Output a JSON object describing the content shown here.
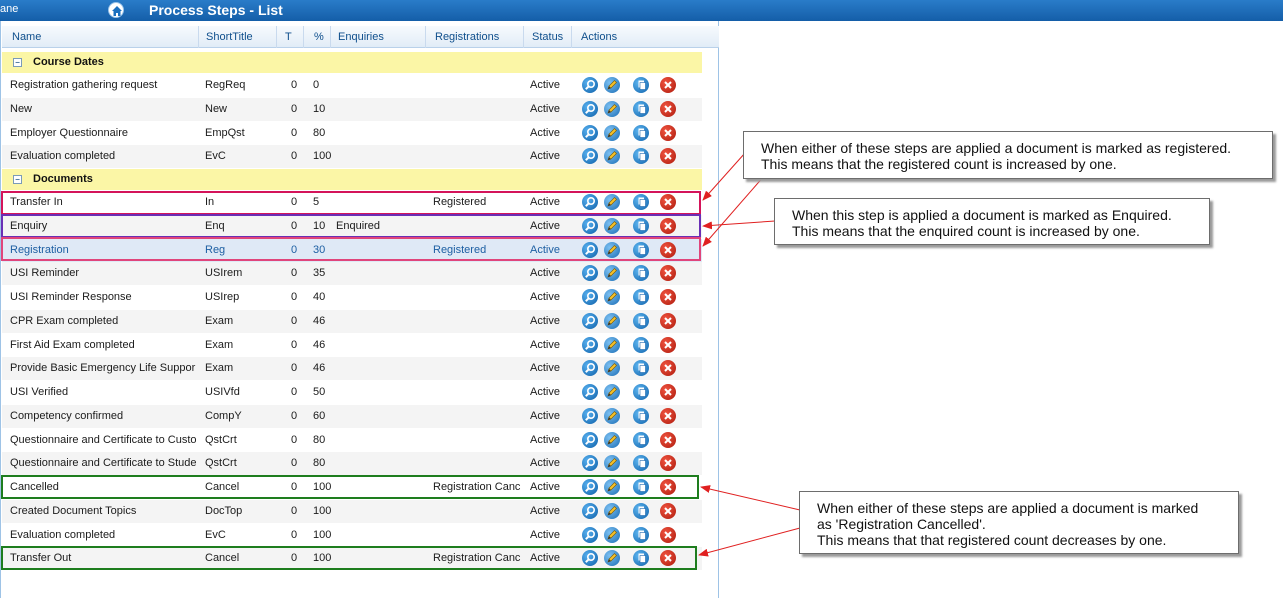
{
  "topbar": {
    "pane_label": "ane",
    "title": "Process Steps - List",
    "home_icon": "home-icon"
  },
  "columns": {
    "name": "Name",
    "short_title": "ShortTitle",
    "t": "T",
    "pct": "%",
    "enquiries": "Enquiries",
    "registrations": "Registrations",
    "status": "Status",
    "actions": "Actions"
  },
  "groups": [
    {
      "label": "Course Dates",
      "rows": [
        {
          "name": "Registration gathering request",
          "short": "RegReq",
          "t": "0",
          "pct": "0",
          "enq": "",
          "reg": "",
          "status": "Active"
        },
        {
          "name": "New",
          "short": "New",
          "t": "0",
          "pct": "10",
          "enq": "",
          "reg": "",
          "status": "Active"
        },
        {
          "name": "Employer Questionnaire",
          "short": "EmpQst",
          "t": "0",
          "pct": "80",
          "enq": "",
          "reg": "",
          "status": "Active"
        },
        {
          "name": "Evaluation completed",
          "short": "EvC",
          "t": "0",
          "pct": "100",
          "enq": "",
          "reg": "",
          "status": "Active"
        }
      ]
    },
    {
      "label": "Documents",
      "rows": [
        {
          "name": "Transfer In",
          "short": "In",
          "t": "0",
          "pct": "5",
          "enq": "",
          "reg": "Registered",
          "status": "Active"
        },
        {
          "name": "Enquiry",
          "short": "Enq",
          "t": "0",
          "pct": "10",
          "enq": "Enquired",
          "reg": "",
          "status": "Active"
        },
        {
          "name": "Registration",
          "short": "Reg",
          "t": "0",
          "pct": "30",
          "enq": "",
          "reg": "Registered",
          "status": "Active"
        },
        {
          "name": "USI Reminder",
          "short": "USIrem",
          "t": "0",
          "pct": "35",
          "enq": "",
          "reg": "",
          "status": "Active"
        },
        {
          "name": "USI Reminder Response",
          "short": "USIrep",
          "t": "0",
          "pct": "40",
          "enq": "",
          "reg": "",
          "status": "Active"
        },
        {
          "name": "CPR Exam completed",
          "short": "Exam",
          "t": "0",
          "pct": "46",
          "enq": "",
          "reg": "",
          "status": "Active"
        },
        {
          "name": "First Aid Exam completed",
          "short": "Exam",
          "t": "0",
          "pct": "46",
          "enq": "",
          "reg": "",
          "status": "Active"
        },
        {
          "name": "Provide Basic Emergency Life Suppor",
          "short": "Exam",
          "t": "0",
          "pct": "46",
          "enq": "",
          "reg": "",
          "status": "Active"
        },
        {
          "name": "USI Verified",
          "short": "USIVfd",
          "t": "0",
          "pct": "50",
          "enq": "",
          "reg": "",
          "status": "Active"
        },
        {
          "name": "Competency confirmed",
          "short": "CompY",
          "t": "0",
          "pct": "60",
          "enq": "",
          "reg": "",
          "status": "Active"
        },
        {
          "name": "Questionnaire and Certificate to Custo",
          "short": "QstCrt",
          "t": "0",
          "pct": "80",
          "enq": "",
          "reg": "",
          "status": "Active"
        },
        {
          "name": "Questionnaire and Certificate to Stude",
          "short": "QstCrt",
          "t": "0",
          "pct": "80",
          "enq": "",
          "reg": "",
          "status": "Active"
        },
        {
          "name": "Cancelled",
          "short": "Cancel",
          "t": "0",
          "pct": "100",
          "enq": "",
          "reg": "Registration Canc",
          "status": "Active"
        },
        {
          "name": "Created Document Topics",
          "short": "DocTop",
          "t": "0",
          "pct": "100",
          "enq": "",
          "reg": "",
          "status": "Active"
        },
        {
          "name": "Evaluation completed",
          "short": "EvC",
          "t": "0",
          "pct": "100",
          "enq": "",
          "reg": "",
          "status": "Active"
        },
        {
          "name": "Transfer Out",
          "short": "Cancel",
          "t": "0",
          "pct": "100",
          "enq": "",
          "reg": "Registration Canc",
          "status": "Active"
        }
      ]
    }
  ],
  "action_icons": [
    "view-icon",
    "edit-icon",
    "copy-icon",
    "delete-icon"
  ],
  "colors": {
    "registered_box": "#d4145a",
    "enquiry_box": "#6a2fb5",
    "registration_box": "#e0457b",
    "cancel_box": "#1e7d1e",
    "arrow": "#e02020"
  },
  "notes": {
    "registered": [
      "When either of these steps are applied a document is marked as registered.",
      "This means that the registered count is increased by one."
    ],
    "enquired": [
      "When this step is applied a document is marked as Enquired.",
      "This means that the enquired count is increased by one."
    ],
    "cancelled": [
      "When either of these steps are applied a document is marked",
      "as 'Registration Cancelled'.",
      "This means that that registered count decreases by one."
    ]
  }
}
